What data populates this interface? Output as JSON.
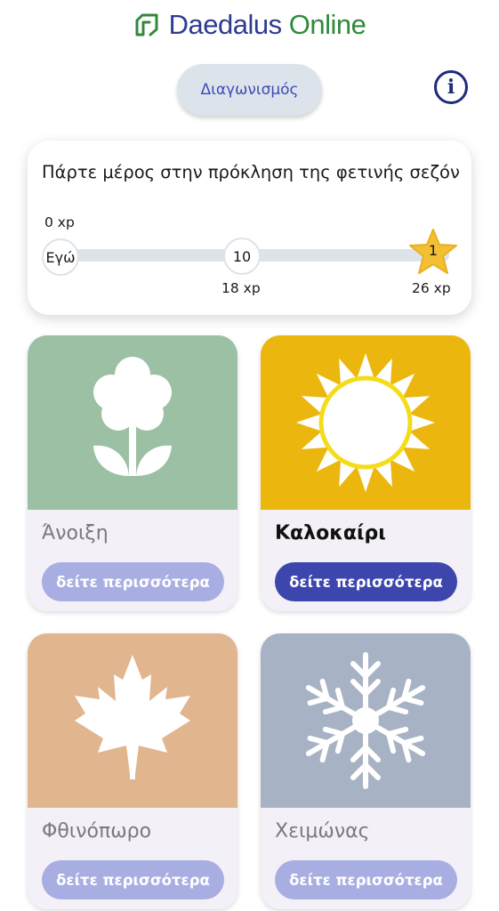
{
  "header": {
    "logo_part1": "Daedalus",
    "logo_part2": "Online"
  },
  "toolbar": {
    "contest_label": "Διαγωνισμός",
    "info_label": "i"
  },
  "challenge": {
    "title": "Πάρτε μέρος στην πρόκληση της φετινής σεζόν",
    "start_xp": "0 xp",
    "me_label": "Εγώ",
    "mid_rank": "10",
    "mid_xp": "18 xp",
    "top_rank": "1",
    "top_xp": "26 xp"
  },
  "seasons": [
    {
      "name": "Άνοιξη",
      "button": "δείτε περισσότερα",
      "color": "#9cc0a3",
      "active": false
    },
    {
      "name": "Καλοκαίρι",
      "button": "δείτε περισσότερα",
      "color": "#ebb70f",
      "active": true
    },
    {
      "name": "Φθινόπωρο",
      "button": "δείτε περισσότερα",
      "color": "#e1b58d",
      "active": false
    },
    {
      "name": "Χειμώνας",
      "button": "δείτε περισσότερα",
      "color": "#a7b3c4",
      "active": false
    }
  ]
}
